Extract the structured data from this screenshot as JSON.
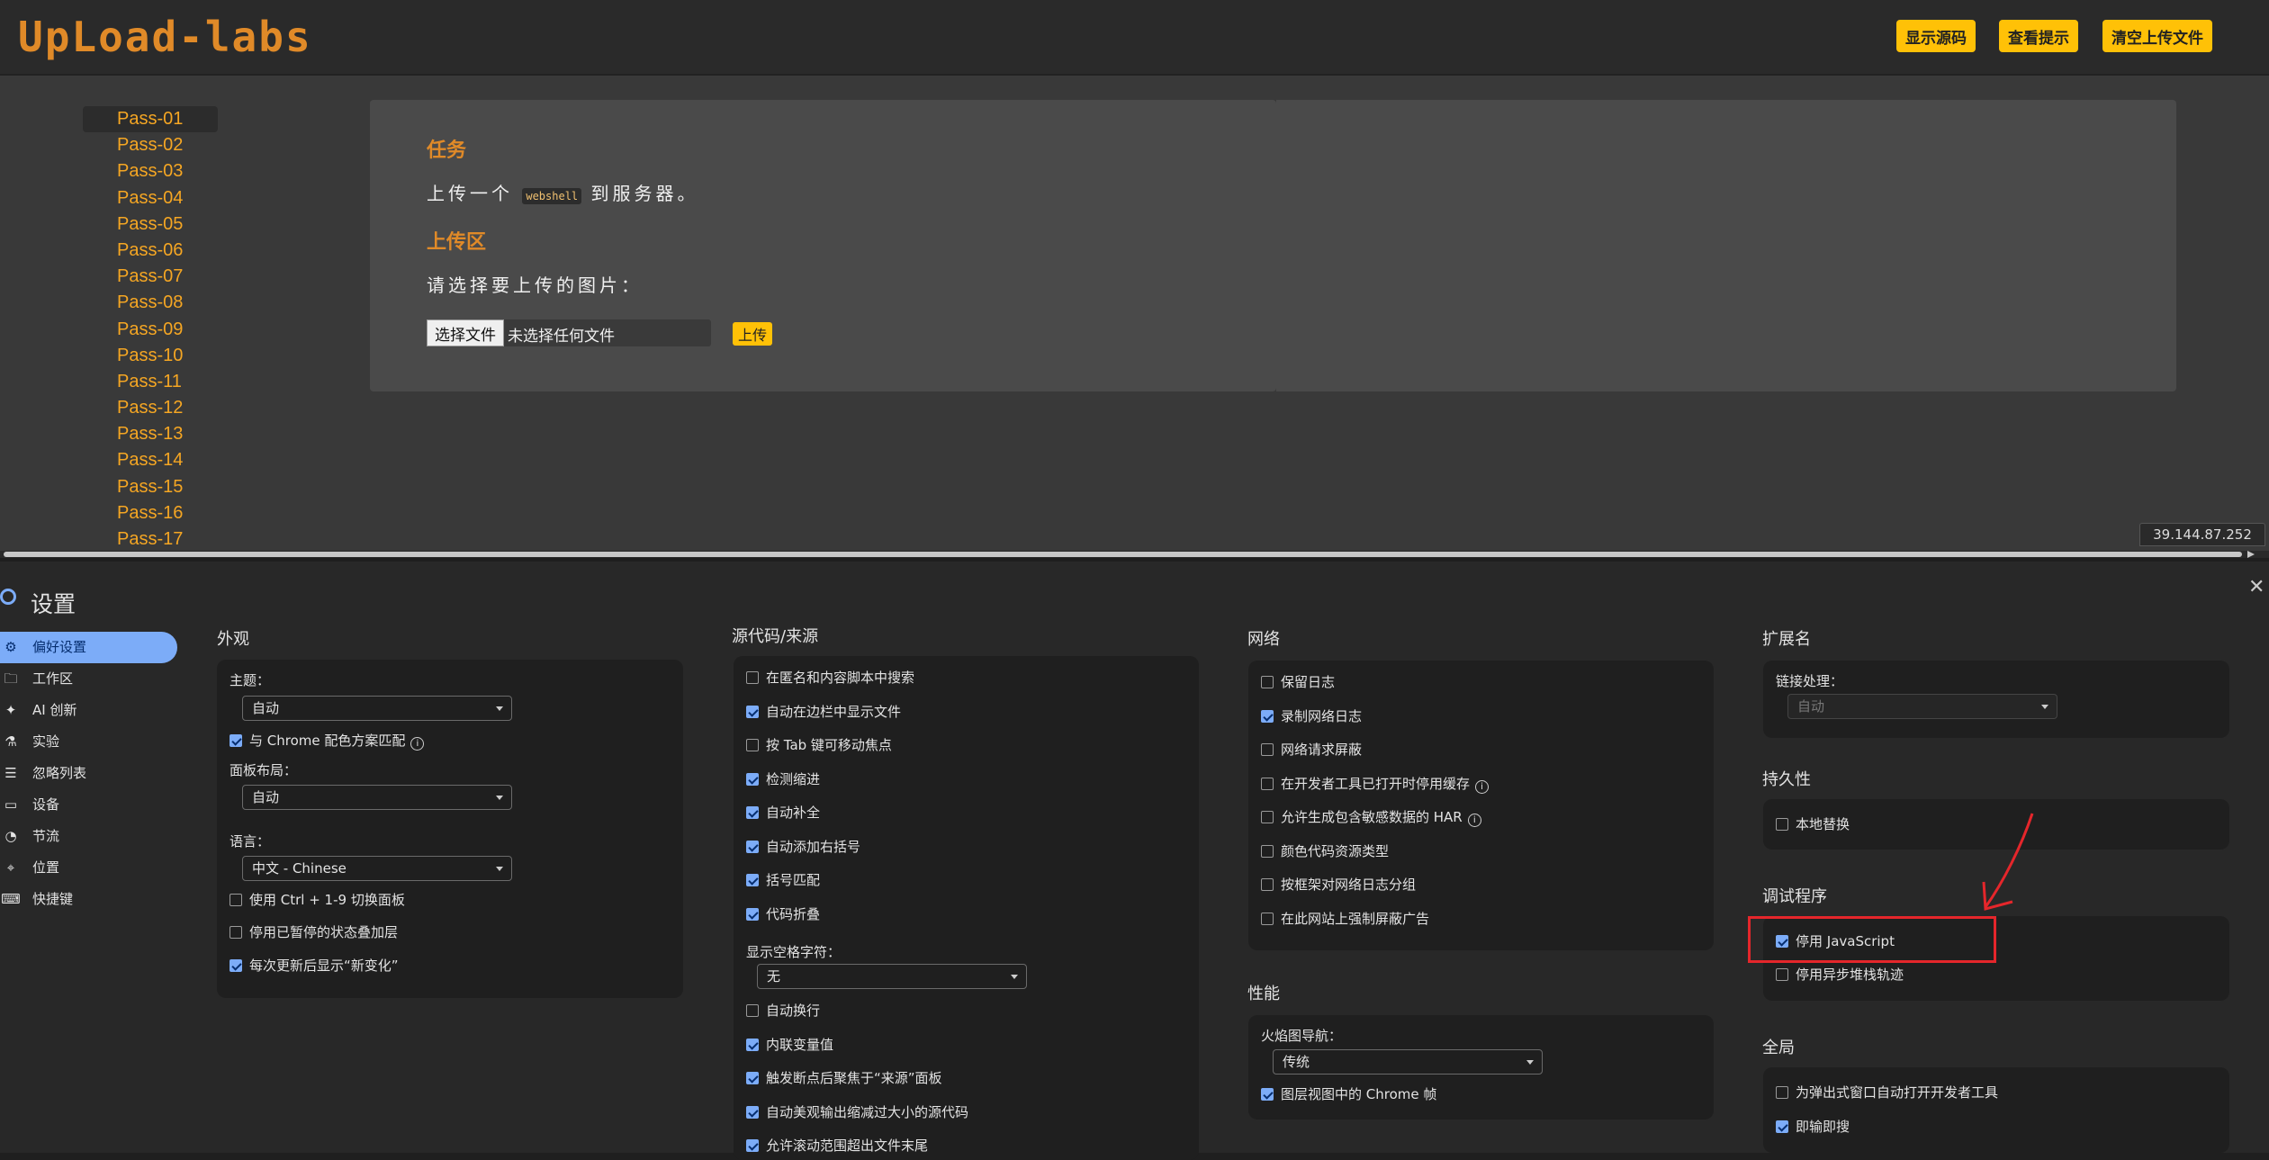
{
  "webpage": {
    "logo": "UpLoad-labs",
    "header_buttons": [
      "显示源码",
      "查看提示",
      "清空上传文件"
    ],
    "pass_items": [
      "Pass-01",
      "Pass-02",
      "Pass-03",
      "Pass-04",
      "Pass-05",
      "Pass-06",
      "Pass-07",
      "Pass-08",
      "Pass-09",
      "Pass-10",
      "Pass-11",
      "Pass-12",
      "Pass-13",
      "Pass-14",
      "Pass-15",
      "Pass-16",
      "Pass-17"
    ],
    "task_title": "任务",
    "task_text_pre": "上传一个",
    "task_code": "webshell",
    "task_text_post": "到服务器。",
    "upload_title": "上传区",
    "upload_prompt": "请选择要上传的图片：",
    "file_button": "选择文件",
    "file_status": "未选择任何文件",
    "upload_button": "上传",
    "ip": "39.144.87.252"
  },
  "devtools": {
    "title": "设置",
    "nav": [
      {
        "icon": "gear-icon",
        "glyph": "⚙",
        "label": "偏好设置",
        "active": true
      },
      {
        "icon": "folder-icon",
        "glyph": "🗀",
        "label": "工作区",
        "active": false
      },
      {
        "icon": "sparkle-icon",
        "glyph": "✦",
        "label": "AI 创新",
        "active": false
      },
      {
        "icon": "flask-icon",
        "glyph": "⚗",
        "label": "实验",
        "active": false
      },
      {
        "icon": "ignore-list-icon",
        "glyph": "☰",
        "label": "忽略列表",
        "active": false
      },
      {
        "icon": "devices-icon",
        "glyph": "▭",
        "label": "设备",
        "active": false
      },
      {
        "icon": "throttle-icon",
        "glyph": "◔",
        "label": "节流",
        "active": false
      },
      {
        "icon": "location-icon",
        "glyph": "⌖",
        "label": "位置",
        "active": false
      },
      {
        "icon": "keyboard-icon",
        "glyph": "⌨",
        "label": "快捷键",
        "active": false
      }
    ],
    "appearance": {
      "title": "外观",
      "theme_label": "主题：",
      "theme_value": "自动",
      "match_chrome": "与 Chrome 配色方案匹配",
      "panel_layout_label": "面板布局：",
      "panel_layout_value": "自动",
      "language_label": "语言：",
      "language_value": "中文 - Chinese",
      "ctrl_switch": "使用 Ctrl + 1-9 切换面板",
      "paused_overlay": "停用已暂停的状态叠加层",
      "show_whats_new": "每次更新后显示“新变化”"
    },
    "sources": {
      "title": "源代码/来源",
      "items": [
        {
          "label": "在匿名和内容脚本中搜索",
          "checked": false
        },
        {
          "label": "自动在边栏中显示文件",
          "checked": true
        },
        {
          "label": "按 Tab 键可移动焦点",
          "checked": false
        },
        {
          "label": "检测缩进",
          "checked": true
        },
        {
          "label": "自动补全",
          "checked": true
        },
        {
          "label": "自动添加右括号",
          "checked": true
        },
        {
          "label": "括号匹配",
          "checked": true
        },
        {
          "label": "代码折叠",
          "checked": true
        }
      ],
      "whitespace_label": "显示空格字符：",
      "whitespace_value": "无",
      "items2": [
        {
          "label": "自动换行",
          "checked": false
        },
        {
          "label": "内联变量值",
          "checked": true
        },
        {
          "label": "触发断点后聚焦于“来源”面板",
          "checked": true
        },
        {
          "label": "自动美观输出缩减过大小的源代码",
          "checked": true
        },
        {
          "label": "允许滚动范围超出文件末尾",
          "checked": true
        }
      ]
    },
    "network": {
      "title": "网络",
      "items": [
        {
          "label": "保留日志",
          "checked": false,
          "info": false
        },
        {
          "label": "录制网络日志",
          "checked": true,
          "info": false
        },
        {
          "label": "网络请求屏蔽",
          "checked": false,
          "info": false
        },
        {
          "label": "在开发者工具已打开时停用缓存",
          "checked": false,
          "info": true
        },
        {
          "label": "允许生成包含敏感数据的 HAR",
          "checked": false,
          "info": true
        },
        {
          "label": "颜色代码资源类型",
          "checked": false,
          "info": false
        },
        {
          "label": "按框架对网络日志分组",
          "checked": false,
          "info": false
        },
        {
          "label": "在此网站上强制屏蔽广告",
          "checked": false,
          "info": false
        }
      ]
    },
    "performance": {
      "title": "性能",
      "flamechart_label": "火焰图导航：",
      "flamechart_value": "传统",
      "chrome_frames": "图层视图中的 Chrome 帧"
    },
    "extensions": {
      "title": "扩展名",
      "link_label": "链接处理：",
      "link_value": "自动"
    },
    "persistence": {
      "title": "持久性",
      "local_overrides": "本地替换"
    },
    "debugger": {
      "title": "调试程序",
      "disable_js": "停用 JavaScript",
      "disable_async": "停用异步堆栈轨迹"
    },
    "global": {
      "title": "全局",
      "auto_open_popup": "为弹出式窗口自动打开开发者工具",
      "search_as_type": "即输即搜"
    }
  },
  "colors": {
    "accent": "#7cacf8",
    "brand_orange": "#e08a28",
    "button_yellow": "#ffc107",
    "highlight_red": "#e5262b"
  }
}
